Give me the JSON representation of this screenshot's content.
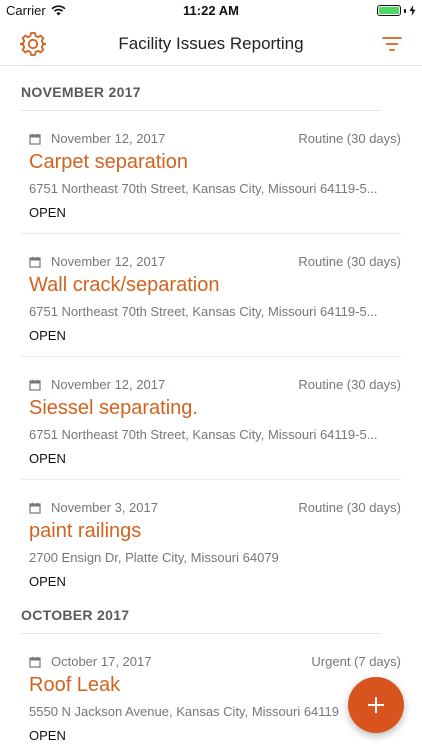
{
  "status_bar": {
    "carrier": "Carrier",
    "time": "11:22 AM"
  },
  "nav": {
    "title": "Facility Issues Reporting",
    "left_icon": "gear-icon",
    "right_icon": "filter-icon"
  },
  "accent_color": "#d2631e",
  "sections": [
    {
      "label": "NOVEMBER 2017",
      "issues": [
        {
          "date": "November 12, 2017",
          "priority": "Routine (30 days)",
          "title": "Carpet separation",
          "address": "6751 Northeast 70th Street, Kansas City, Missouri 64119-5...",
          "status": "OPEN"
        },
        {
          "date": "November 12, 2017",
          "priority": "Routine (30 days)",
          "title": "Wall crack/separation",
          "address": "6751 Northeast 70th Street, Kansas City, Missouri 64119-5...",
          "status": "OPEN"
        },
        {
          "date": "November 12, 2017",
          "priority": "Routine (30 days)",
          "title": "Siessel separating.",
          "address": "6751 Northeast 70th Street, Kansas City, Missouri 64119-5...",
          "status": "OPEN"
        },
        {
          "date": "November 3, 2017",
          "priority": "Routine (30 days)",
          "title": "paint railings",
          "address": "2700 Ensign Dr, Platte City, Missouri 64079",
          "status": "OPEN"
        }
      ]
    },
    {
      "label": "OCTOBER 2017",
      "issues": [
        {
          "date": "October 17, 2017",
          "priority": "Urgent (7 days)",
          "title": "Roof Leak",
          "address": "5550 N Jackson Avenue, Kansas City, Missouri 64119",
          "status": "OPEN"
        }
      ]
    }
  ],
  "fab": {
    "icon": "plus-icon"
  }
}
